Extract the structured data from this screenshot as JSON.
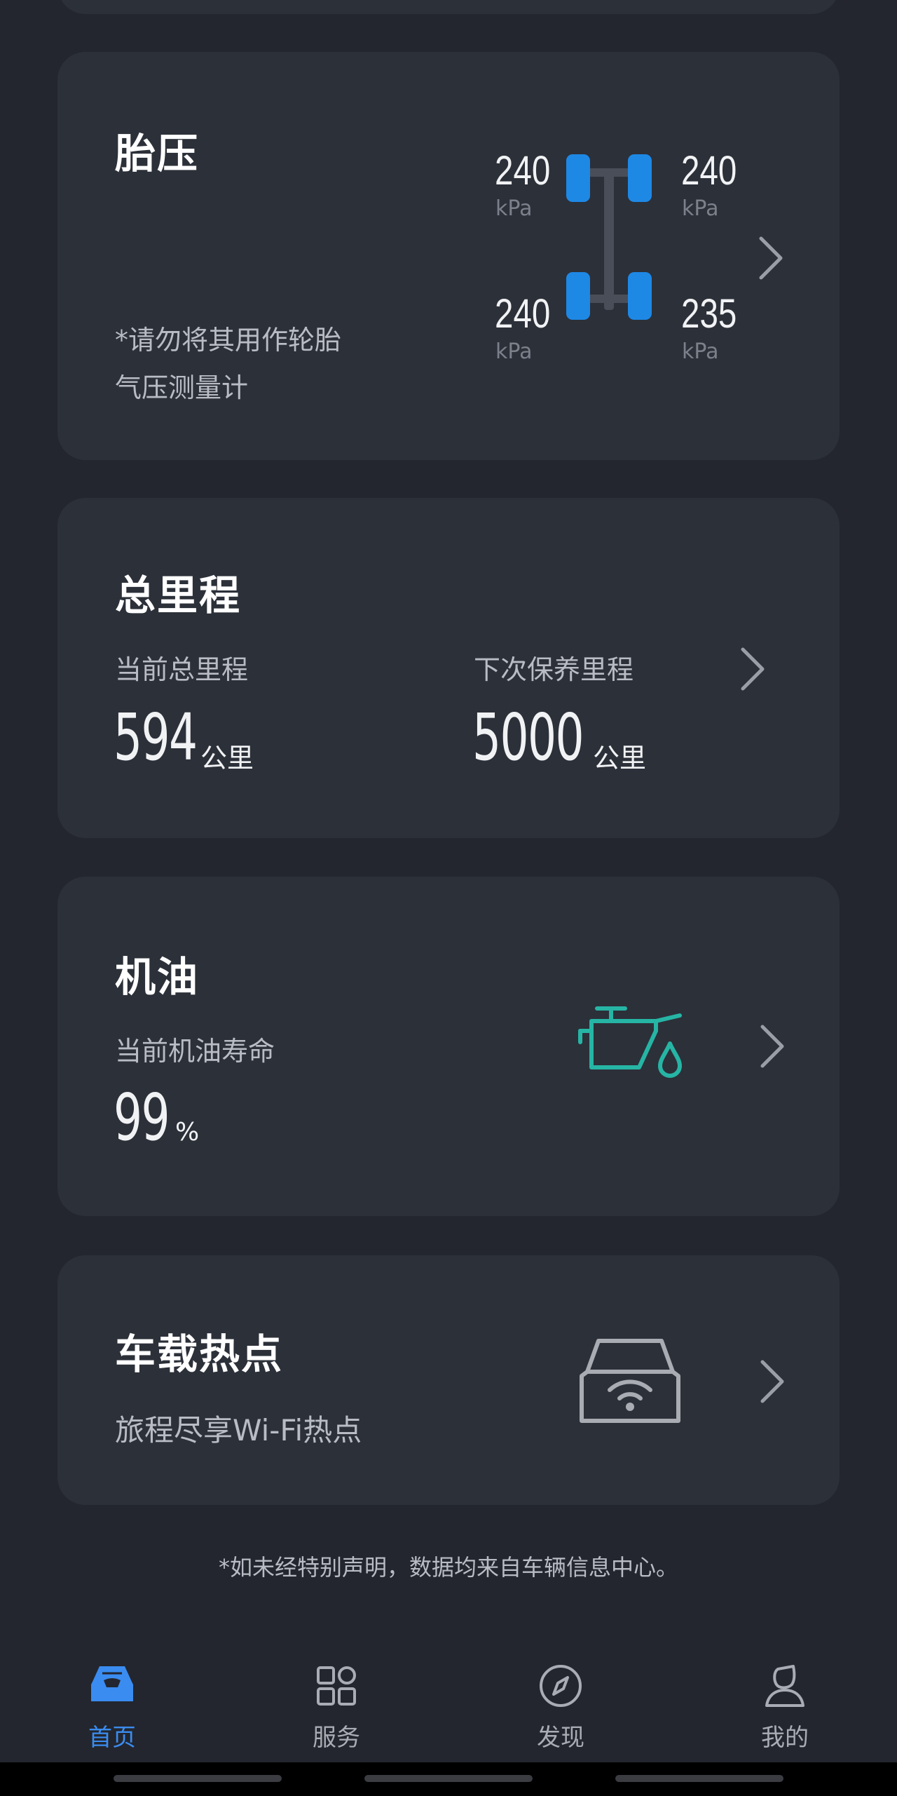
{
  "tire_pressure": {
    "title": "胎压",
    "note_line1": "*请勿将其用作轮胎",
    "note_line2": "气压测量计",
    "unit": "kPa",
    "front_left": "240",
    "front_right": "240",
    "rear_left": "240",
    "rear_right": "235",
    "wheel_color": "#1e88e5"
  },
  "mileage": {
    "title": "总里程",
    "current_label": "当前总里程",
    "current_value": "594",
    "next_service_label": "下次保养里程",
    "next_service_value": "5000",
    "unit": "公里"
  },
  "oil": {
    "title": "机油",
    "label": "当前机油寿命",
    "value": "99",
    "unit": "%",
    "icon": "oil-can-icon",
    "icon_color": "#26b5a5"
  },
  "hotspot": {
    "title": "车载热点",
    "subtitle": "旅程尽享Wi-Fi热点",
    "icon": "car-wifi-icon"
  },
  "footnote": "*如未经特别声明，数据均来自车辆信息中心。",
  "nav": {
    "items": [
      {
        "label": "首页",
        "icon": "car-home-icon",
        "active": true
      },
      {
        "label": "服务",
        "icon": "grid-services-icon",
        "active": false
      },
      {
        "label": "发现",
        "icon": "compass-icon",
        "active": false
      },
      {
        "label": "我的",
        "icon": "profile-icon",
        "active": false
      }
    ],
    "active_color": "#3a8cf0"
  }
}
